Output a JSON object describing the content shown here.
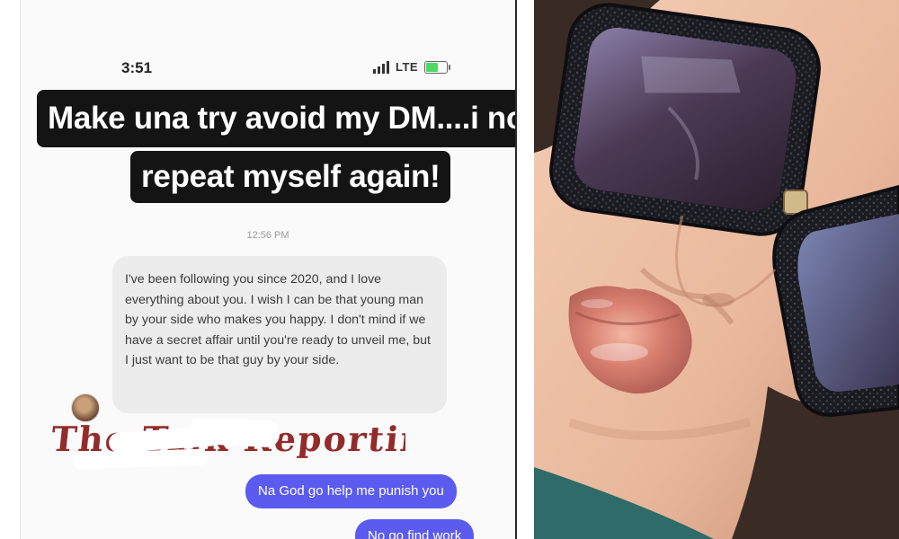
{
  "left": {
    "status_bar": {
      "time": "3:51",
      "network": "LTE"
    },
    "caption": {
      "line1": "Make una try avoid my DM....i no go",
      "line2": "repeat myself again!"
    },
    "timestamp": "12:56 PM",
    "received_message": "I've been following you since 2020, and I love everything about you. I wish I can be that young man by your side who makes you happy. I don't mind if we have a secret affair until you're ready to unveil me, but I just want to be that guy by your side.",
    "redacted_watermark": "The Talk Reporting",
    "sent_messages": [
      "Na God go help me punish you",
      "No go find work"
    ],
    "colors": {
      "caption_bg": "#141414",
      "sent_bubble": "#5b5bf0",
      "received_bubble": "#ececec",
      "watermark": "#8b1a1a"
    }
  },
  "right": {
    "photo_subject": "close-up of face with black jeweled square sunglasses and glossy lips",
    "colors": {
      "skin": "#efc6ad",
      "frames": "#1a1a22",
      "lens": "#5a3e5e",
      "lips": "#d47d70"
    }
  }
}
